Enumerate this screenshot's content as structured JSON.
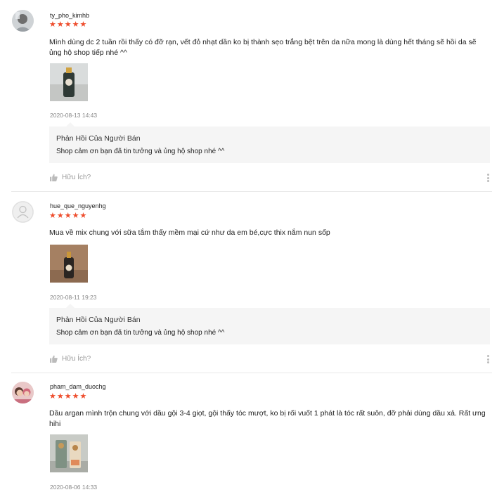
{
  "reviews": [
    {
      "username": "ty_pho_kimhb",
      "stars": "★★★★★",
      "comment": "Mình dùng dc 2 tuần rồi thấy có đỡ rạn, vết đỏ nhạt dần ko bị thành sẹo trắng bệt trên da nữa mong là dùng hết tháng sẽ hồi da sẽ ủng hộ shop tiếp nhé ^^",
      "date": "2020-08-13 14:43",
      "reply_title": "Phản Hồi Của Người Bán",
      "reply_text": "Shop cảm ơn bạn đã tin tưởng và ủng hộ shop nhé ^^",
      "helpful": "Hữu Ích?"
    },
    {
      "username": "hue_que_nguyenhg",
      "stars": "★★★★★",
      "comment": "Mua về mix chung với sữa tắm thấy mềm mại cứ như da em bé,cực thix nắm nun sốp",
      "date": "2020-08-11 19:23",
      "reply_title": "Phản Hồi Của Người Bán",
      "reply_text": "Shop cảm ơn bạn đã tin tưởng và ủng hộ shop nhé ^^",
      "helpful": "Hữu Ích?"
    },
    {
      "username": "pham_dam_duochg",
      "stars": "★★★★★",
      "comment": "Dầu argan mình trộn chung với dầu gội 3-4 giọt, gội thấy tóc mượt, ko bị rối vuốt 1 phát là tóc rất suôn, đỡ phải dùng dầu xả. Rất ưng hihi",
      "date": "2020-08-06 14:33"
    }
  ],
  "colors": {
    "star": "#ee4d2d",
    "reply_bg": "#f5f5f5",
    "muted": "#888888"
  },
  "icons": {
    "helpful": "thumbs-up-icon",
    "more": "more-vertical-icon",
    "default_avatar": "user-icon"
  }
}
